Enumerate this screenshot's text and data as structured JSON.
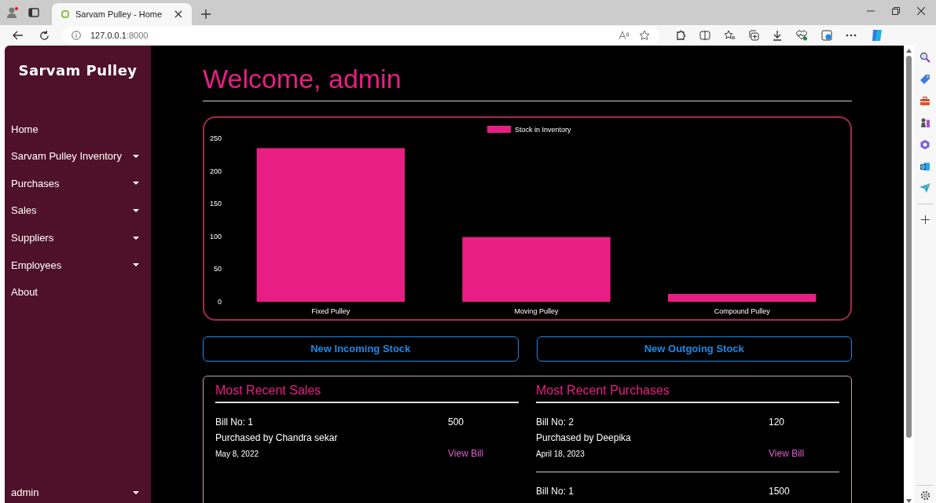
{
  "browser": {
    "tab_title": "Sarvam Pulley - Home",
    "url_host": "127.0.0.1",
    "url_port": ":8000"
  },
  "sidebar": {
    "brand": "Sarvam Pulley",
    "items": [
      {
        "label": "Home",
        "dropdown": false
      },
      {
        "label": "Sarvam Pulley Inventory",
        "dropdown": true
      },
      {
        "label": "Purchases",
        "dropdown": true
      },
      {
        "label": "Sales",
        "dropdown": true
      },
      {
        "label": "Suppliers",
        "dropdown": true
      },
      {
        "label": "Employees",
        "dropdown": true
      },
      {
        "label": "About",
        "dropdown": false
      }
    ],
    "user": {
      "label": "admin",
      "dropdown": true
    }
  },
  "heading": "Welcome, admin",
  "chart_data": {
    "type": "bar",
    "categories": [
      "Fixed Pulley",
      "Moving Pulley",
      "Compound Pulley"
    ],
    "series": [
      {
        "name": "Stock in Inventory",
        "color": "#e91e84",
        "values": [
          235,
          99,
          12
        ]
      }
    ],
    "ylim": [
      0,
      250
    ],
    "yticks": [
      0,
      50,
      100,
      150,
      200,
      250
    ]
  },
  "buttons": [
    "New Incoming Stock",
    "New Outgoing Stock"
  ],
  "lists": [
    {
      "title": "Most Recent Sales",
      "entries": [
        {
          "bill": "Bill No: 1",
          "amount": "500",
          "party": "Purchased by Chandra sekar",
          "date": "May 8, 2022",
          "link": "View Bill"
        }
      ]
    },
    {
      "title": "Most Recent Purchases",
      "entries": [
        {
          "bill": "Bill No: 2",
          "amount": "120",
          "party": "Purchased by Deepika",
          "date": "April 18, 2023",
          "link": "View Bill"
        },
        {
          "bill": "Bill No: 1",
          "amount": "1500"
        }
      ]
    }
  ]
}
